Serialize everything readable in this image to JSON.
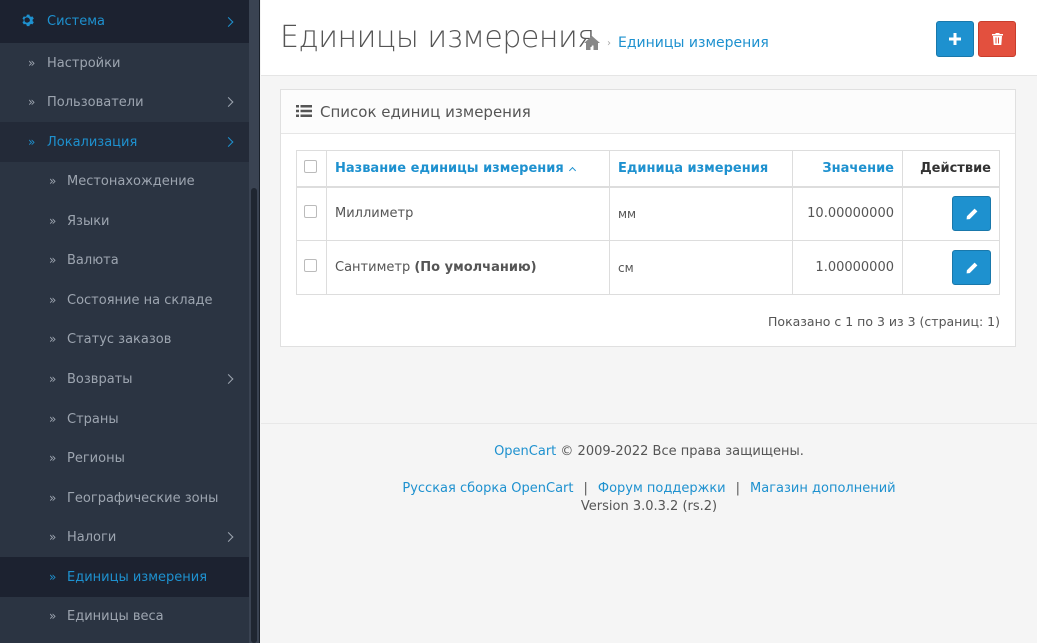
{
  "sidebar": {
    "items": [
      {
        "label": "Система"
      },
      {
        "label": "Настройки"
      },
      {
        "label": "Пользователи"
      },
      {
        "label": "Локализация"
      },
      {
        "label": "Местонахождение"
      },
      {
        "label": "Языки"
      },
      {
        "label": "Валюта"
      },
      {
        "label": "Состояние на складе"
      },
      {
        "label": "Статус заказов"
      },
      {
        "label": "Возвраты"
      },
      {
        "label": "Страны"
      },
      {
        "label": "Регионы"
      },
      {
        "label": "Географические зоны"
      },
      {
        "label": "Налоги"
      },
      {
        "label": "Единицы измерения"
      },
      {
        "label": "Единицы веса"
      }
    ],
    "arrow_glyph": "»"
  },
  "header": {
    "title": "Единицы измерения",
    "breadcrumb": "Единицы измерения",
    "breadcrumb_sep": "›"
  },
  "panel": {
    "title": "Список единиц измерения",
    "columns": {
      "name": "Название единицы измерения",
      "unit": "Единица измерения",
      "value": "Значение",
      "action": "Действие"
    },
    "rows": [
      {
        "name": "Миллиметр",
        "default_label": "",
        "unit": "мм",
        "value": "10.00000000"
      },
      {
        "name": "Сантиметр",
        "default_label": "(По умолчанию)",
        "unit": "см",
        "value": "1.00000000"
      }
    ],
    "pagination": "Показано с 1 по 3 из 3 (страниц: 1)"
  },
  "footer": {
    "brand": "OpenCart",
    "copyright": "© 2009-2022 Все права защищены.",
    "links": [
      "Русская сборка OpenCart",
      "Форум поддержки",
      "Магазин дополнений"
    ],
    "separator": "|",
    "version": "Version 3.0.3.2 (rs.2)"
  },
  "colors": {
    "accent": "#1e91cf",
    "danger": "#e3503e",
    "sidebar_bg": "#2b3442"
  },
  "icons": {
    "settings": "gear-icon",
    "home": "home-icon",
    "list": "list-icon",
    "add": "plus-icon",
    "delete": "trash-icon",
    "edit": "pencil-icon"
  }
}
